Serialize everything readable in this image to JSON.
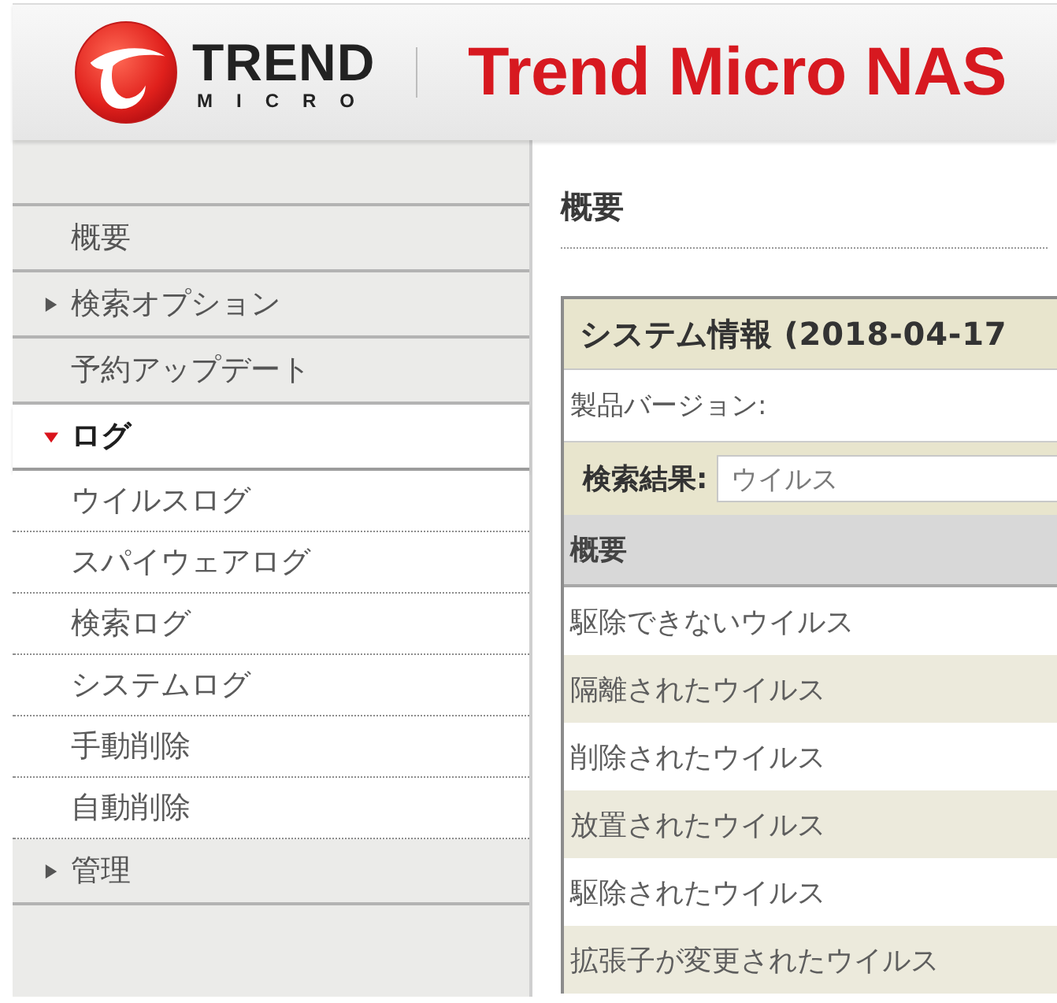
{
  "header": {
    "brand_name": "TREND",
    "brand_subname": "MICRO",
    "product_title": "Trend Micro NAS"
  },
  "sidebar": {
    "items": [
      {
        "label": "概要",
        "kind": "link"
      },
      {
        "label": "検索オプション",
        "kind": "group",
        "expanded": false
      },
      {
        "label": "予約アップデート",
        "kind": "link"
      },
      {
        "label": "ログ",
        "kind": "group",
        "expanded": true,
        "children": [
          {
            "label": "ウイルスログ"
          },
          {
            "label": "スパイウェアログ"
          },
          {
            "label": "検索ログ"
          },
          {
            "label": "システムログ"
          },
          {
            "label": "手動削除"
          },
          {
            "label": "自動削除"
          }
        ]
      },
      {
        "label": "管理",
        "kind": "group",
        "expanded": false
      }
    ]
  },
  "main": {
    "title": "概要",
    "panel": {
      "title": "システム情報 (2018-04-17",
      "version_label": "製品バージョン:",
      "filter": {
        "label": "検索結果:",
        "value": "ウイルス"
      },
      "table": {
        "columns": [
          "概要"
        ],
        "rows": [
          [
            "駆除できないウイルス"
          ],
          [
            "隔離されたウイルス"
          ],
          [
            "削除されたウイルス"
          ],
          [
            "放置されたウイルス"
          ],
          [
            "駆除されたウイルス"
          ],
          [
            "拡張子が変更されたウイルス"
          ]
        ]
      }
    }
  }
}
